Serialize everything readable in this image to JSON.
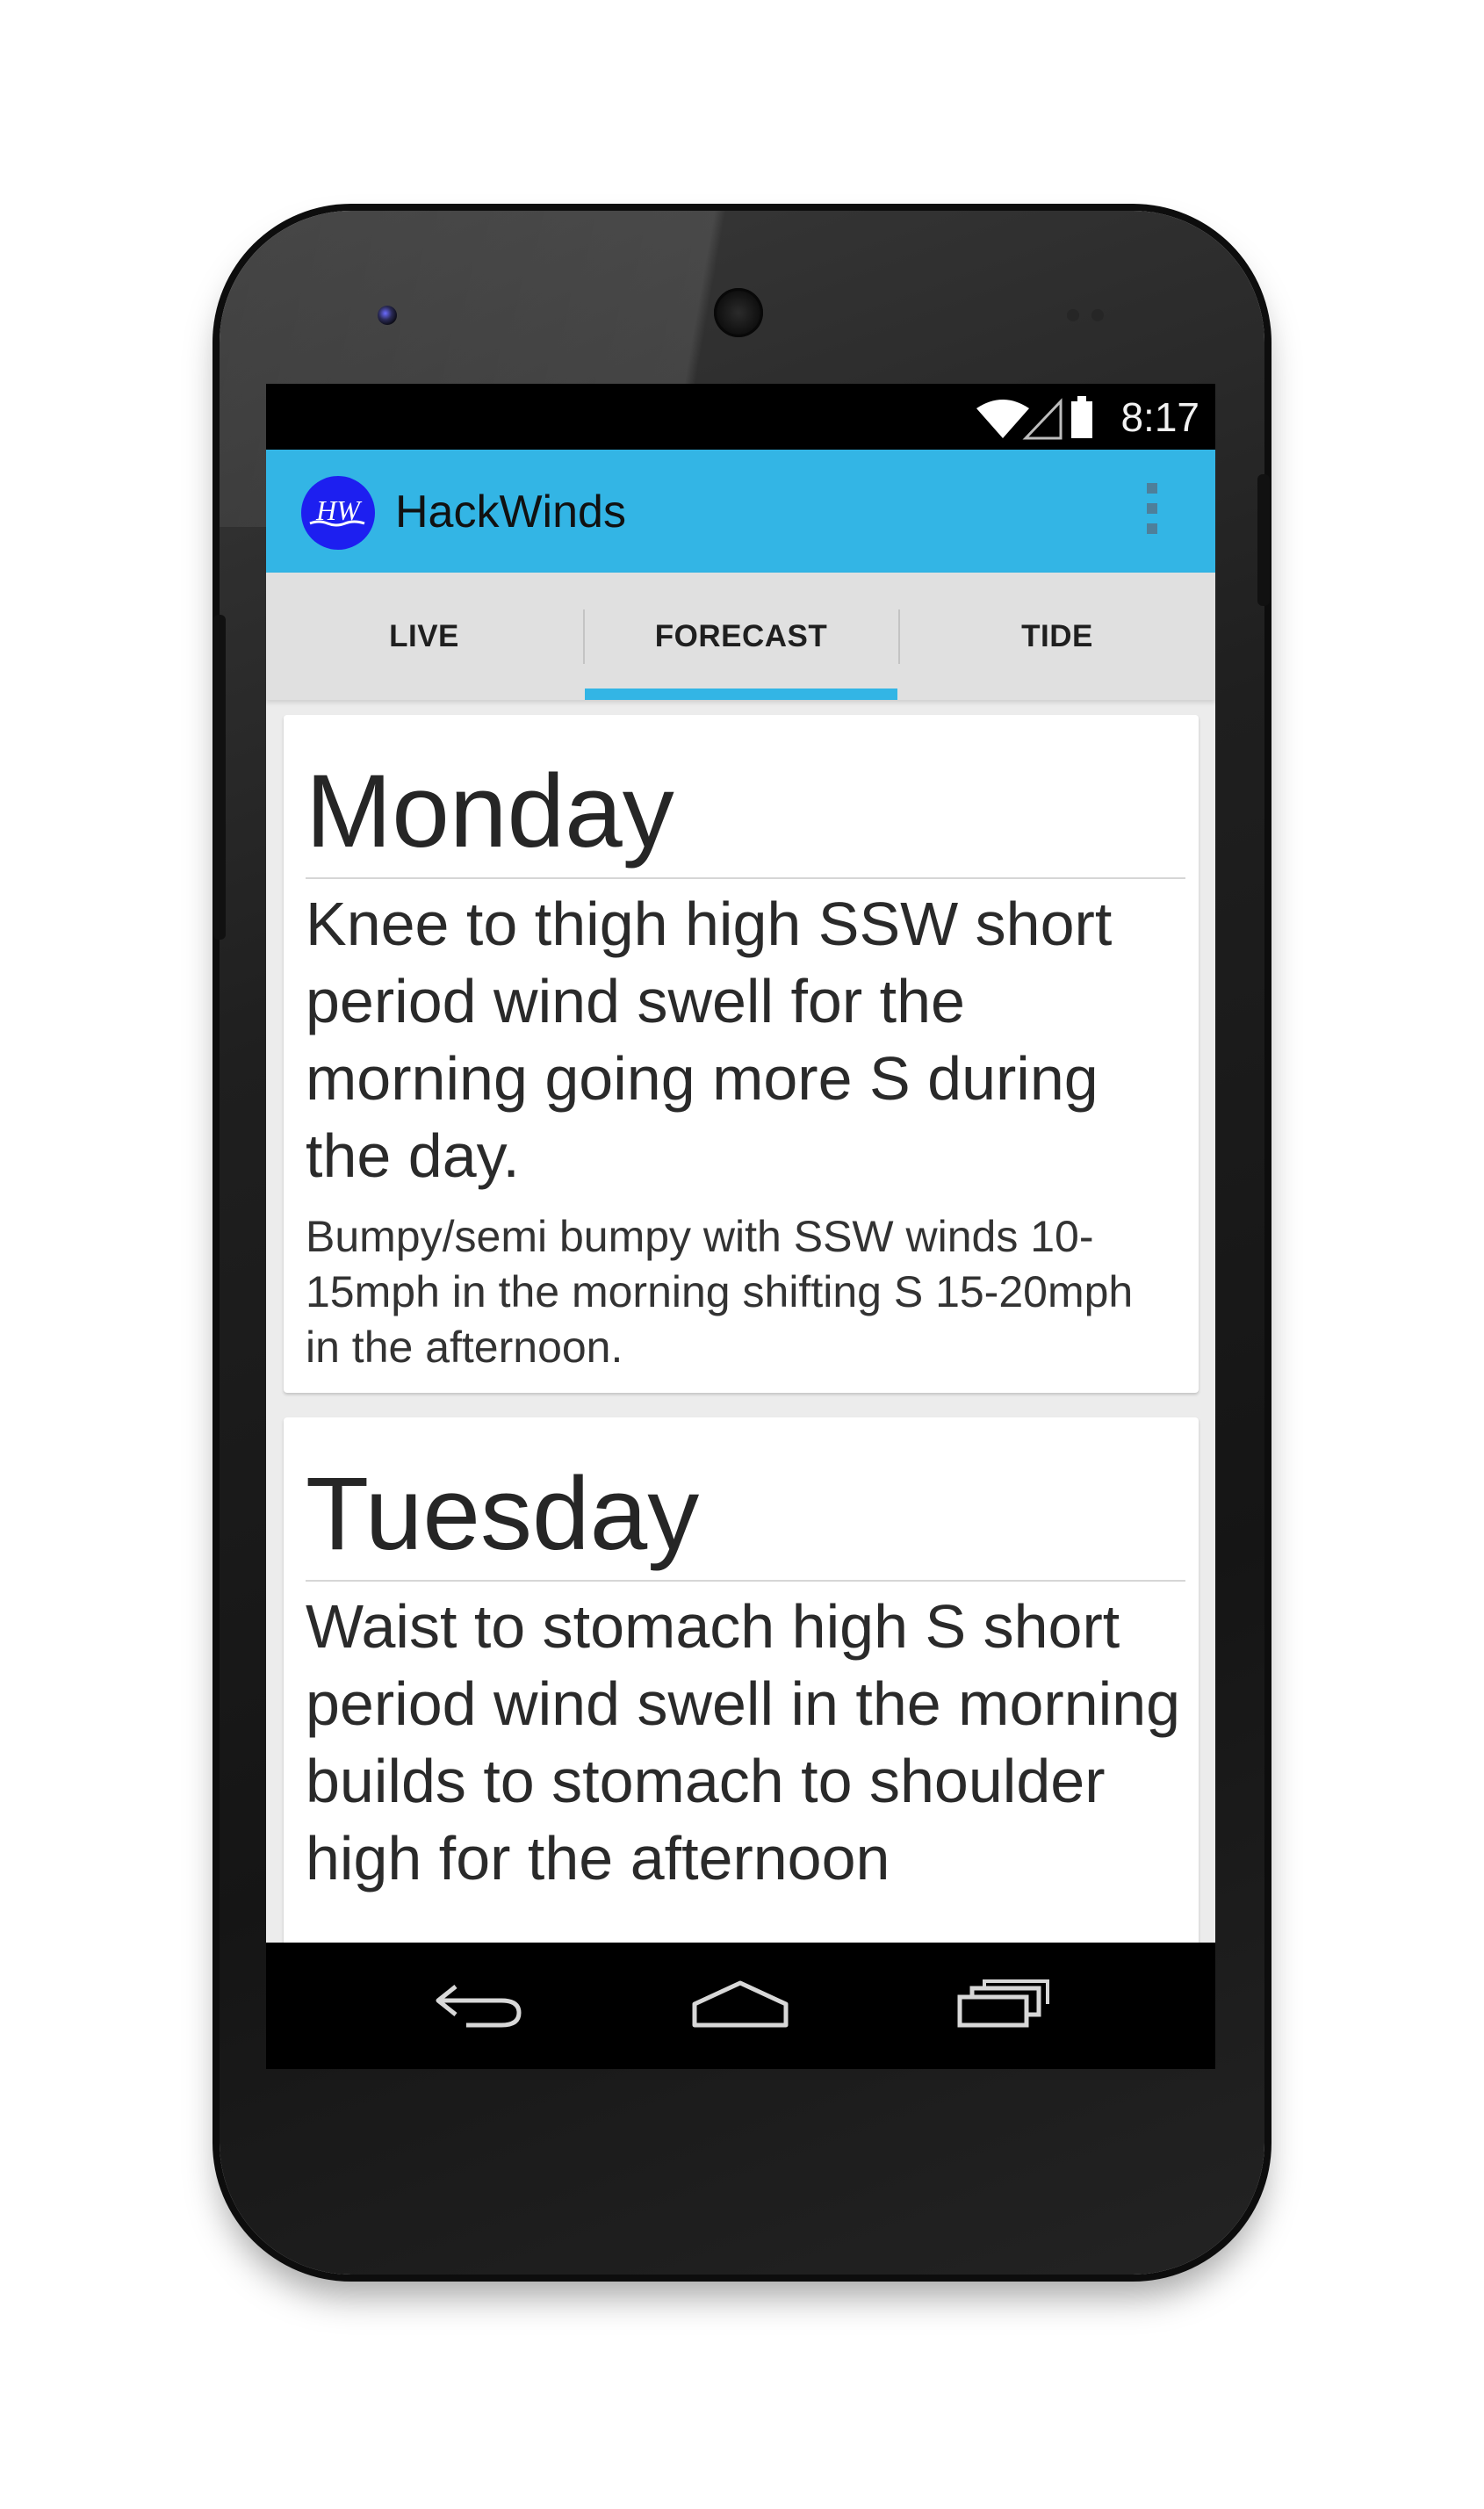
{
  "status_bar": {
    "time": "8:17",
    "icons": [
      "wifi-icon",
      "signal-icon",
      "battery-icon"
    ]
  },
  "action_bar": {
    "logo_text": "HW",
    "title": "HackWinds",
    "overflow_icon": "more-vert-icon",
    "color": "#33b5e5"
  },
  "tabs": [
    {
      "label": "LIVE",
      "selected": false
    },
    {
      "label": "FORECAST",
      "selected": true
    },
    {
      "label": "TIDE",
      "selected": false
    }
  ],
  "forecast": [
    {
      "day": "Monday",
      "swell": "Knee to thigh high SSW short period wind swell for the morning going more S during the day.",
      "wind": "Bumpy/semi bumpy with SSW winds 10-15mph in the morning shifting S 15-20mph in the afternoon."
    },
    {
      "day": "Tuesday",
      "swell": "Waist to stomach high S short period wind swell in the morning builds to stomach to shoulder high for the afternoon",
      "wind": ""
    }
  ],
  "nav_bar": {
    "back_icon": "back-icon",
    "home_icon": "home-icon",
    "recents_icon": "recents-icon"
  }
}
